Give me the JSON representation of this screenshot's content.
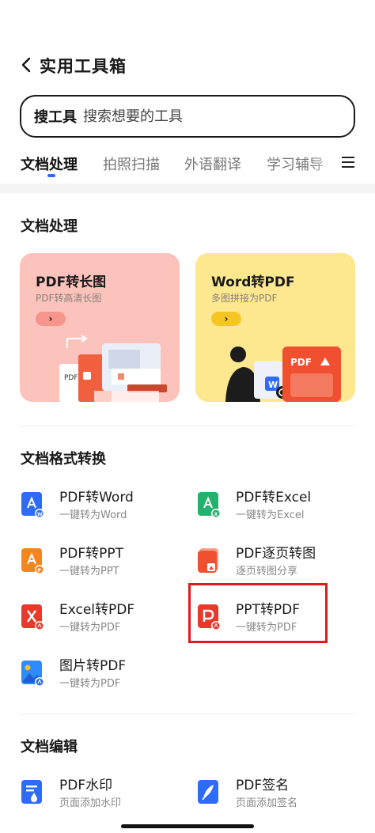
{
  "header": {
    "title": "实用工具箱"
  },
  "search": {
    "label": "搜工具",
    "placeholder": "搜索想要的工具"
  },
  "tabs": [
    {
      "label": "文档处理",
      "active": true
    },
    {
      "label": "拍照扫描",
      "active": false
    },
    {
      "label": "外语翻译",
      "active": false
    },
    {
      "label": "学习辅导",
      "active": false
    }
  ],
  "sections": {
    "doc_processing": {
      "title": "文档处理"
    },
    "format_convert": {
      "title": "文档格式转换"
    },
    "doc_edit": {
      "title": "文档编辑"
    }
  },
  "feature_cards": [
    {
      "title": "PDF转长图",
      "subtitle": "PDF转高清长图",
      "arrow": "›",
      "art_label": "PDF",
      "color": "#fcc3bd"
    },
    {
      "title": "Word转PDF",
      "subtitle": "多图拼接为PDF",
      "arrow": "›",
      "art_label": "PDF",
      "art_word": "W",
      "color": "#fde890"
    }
  ],
  "convert_tools": [
    {
      "name": "PDF转Word",
      "desc": "一键转为Word",
      "icon": "pdf-to-word-icon",
      "color": "#2f6cf6"
    },
    {
      "name": "PDF转Excel",
      "desc": "一键转为Excel",
      "icon": "pdf-to-excel-icon",
      "color": "#23b26d"
    },
    {
      "name": "PDF转PPT",
      "desc": "一键转为PPT",
      "icon": "pdf-to-ppt-icon",
      "color": "#f5861f"
    },
    {
      "name": "PDF逐页转图",
      "desc": "逐页转图分享",
      "icon": "pdf-page-to-image-icon",
      "color": "#f0502f"
    },
    {
      "name": "Excel转PDF",
      "desc": "一键转为PDF",
      "icon": "excel-to-pdf-icon",
      "color": "#e8392b"
    },
    {
      "name": "PPT转PDF",
      "desc": "一键转为PDF",
      "icon": "ppt-to-pdf-icon",
      "color": "#e8392b",
      "highlighted": true
    },
    {
      "name": "图片转PDF",
      "desc": "一键转为PDF",
      "icon": "image-to-pdf-icon",
      "color": "#2f8cf6"
    }
  ],
  "edit_tools": [
    {
      "name": "PDF水印",
      "desc": "页面添加水印",
      "icon": "pdf-watermark-icon",
      "color": "#2f6cf6"
    },
    {
      "name": "PDF签名",
      "desc": "页面添加签名",
      "icon": "pdf-signature-icon",
      "color": "#2f6cf6"
    }
  ],
  "colors": {
    "accent": "#2f6cf6",
    "highlight_border": "#e11a1a"
  }
}
